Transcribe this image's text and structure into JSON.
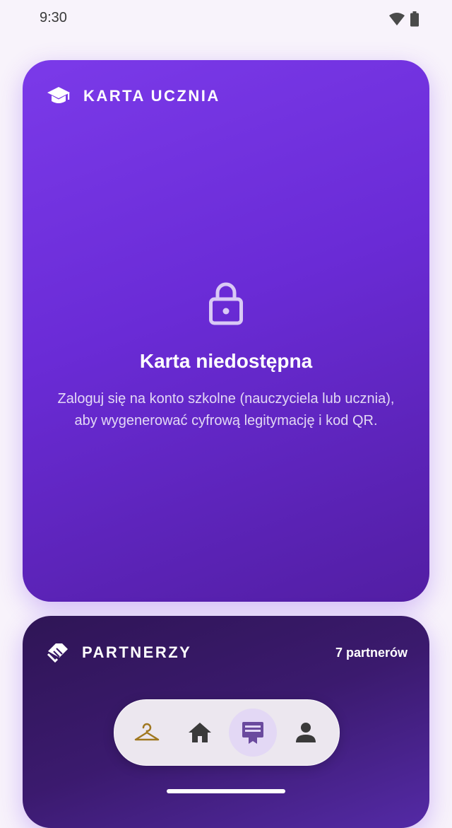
{
  "status_bar": {
    "time": "9:30"
  },
  "student_card": {
    "icon": "graduation-cap-icon",
    "title": "KARTA UCZNIA",
    "lock_icon": "lock-icon",
    "unavailable_title": "Karta niedostępna",
    "unavailable_description": "Zaloguj się na konto szkolne (nauczyciela lub ucznia), aby wygenerować cyfrową legitymację i kod QR."
  },
  "partners_card": {
    "icon": "handshake-icon",
    "title": "PARTNERZY",
    "count_label": "7 partnerów"
  },
  "bottom_nav": {
    "items": [
      {
        "icon": "hanger-icon",
        "active": false
      },
      {
        "icon": "home-icon",
        "active": false
      },
      {
        "icon": "card-badge-icon",
        "active": true
      },
      {
        "icon": "person-icon",
        "active": false
      }
    ]
  },
  "colors": {
    "accent": "#7c3aed",
    "card_gradient_start": "#7b3ae9",
    "card_gradient_end": "#521ea3",
    "hanger": "#a07820",
    "active_nav": "#e3d8f5"
  }
}
